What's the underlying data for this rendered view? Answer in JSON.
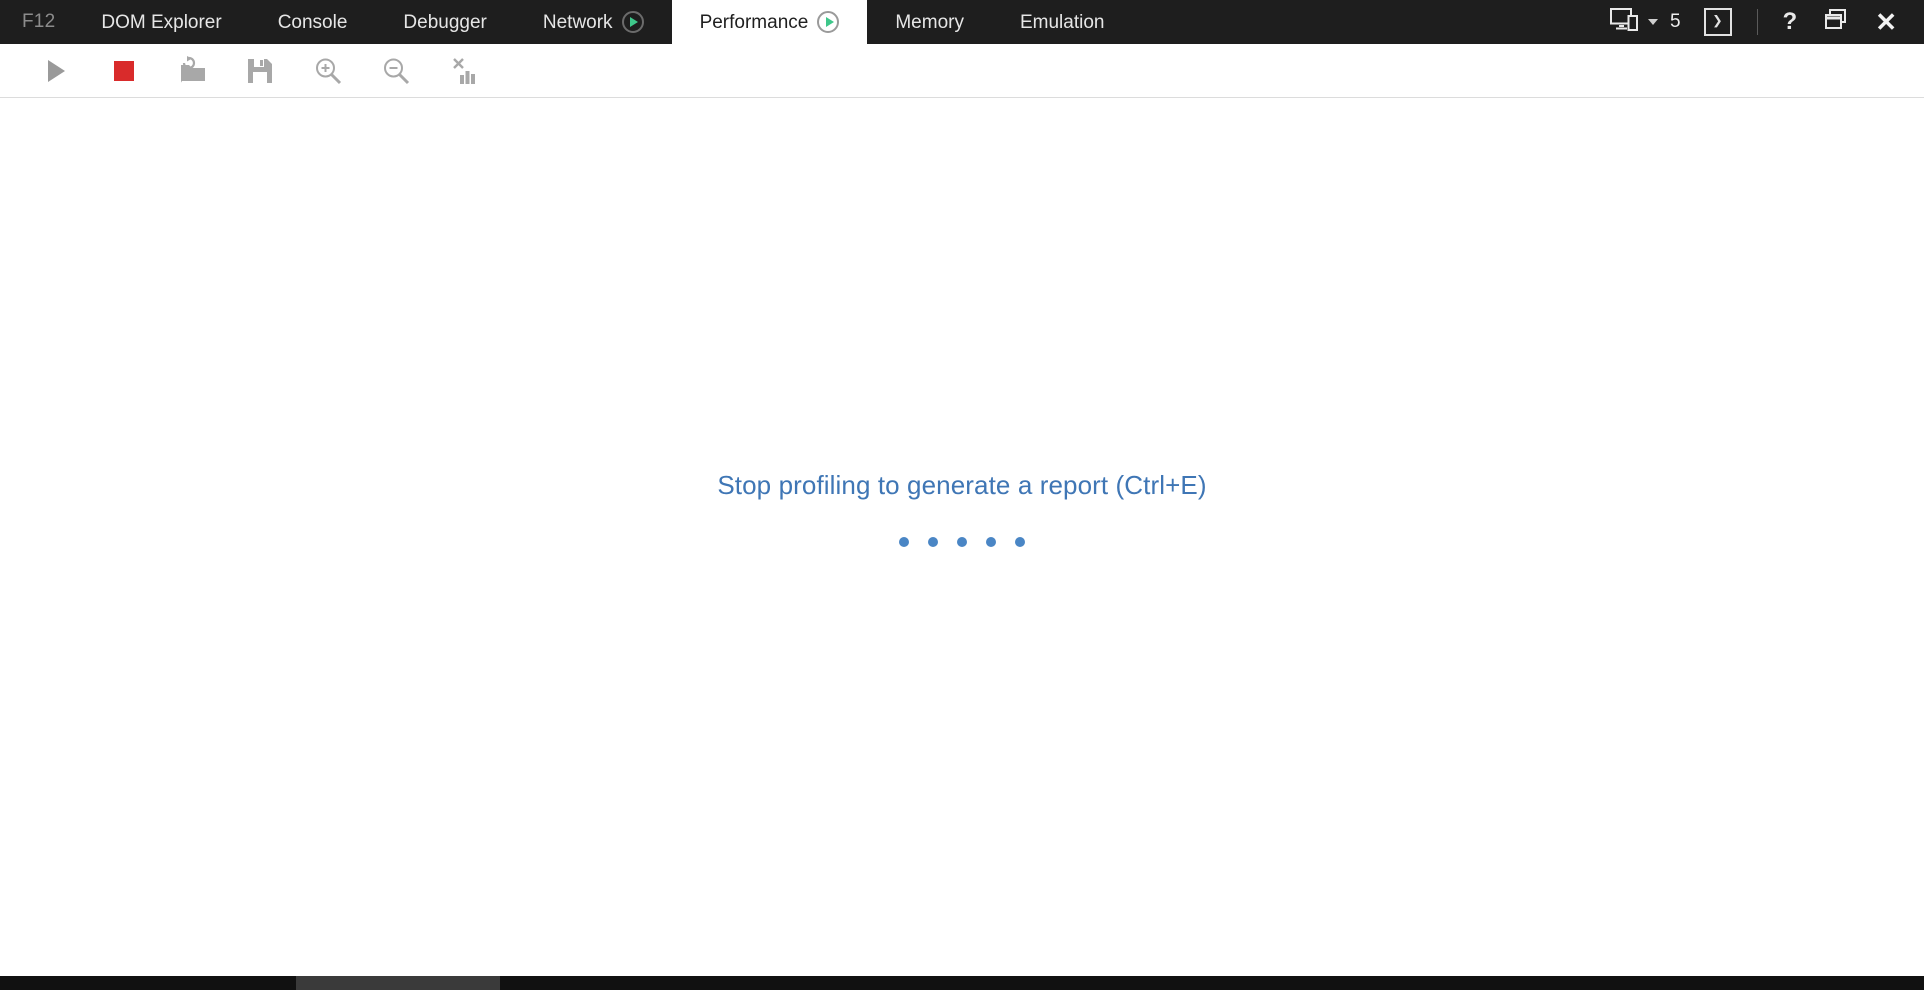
{
  "window": {
    "shortcut_label": "F12",
    "colors": {
      "tabbar_bg": "#1e1e1e",
      "active_tab_bg": "#ffffff",
      "accent_blue": "#3f76b5",
      "record_green": "#3ec78a",
      "stop_red": "#d92b2b"
    }
  },
  "tabs": [
    {
      "label": "DOM Explorer",
      "active": false,
      "recording": false,
      "icon": ""
    },
    {
      "label": "Console",
      "active": false,
      "recording": false,
      "icon": ""
    },
    {
      "label": "Debugger",
      "active": false,
      "recording": false,
      "icon": ""
    },
    {
      "label": "Network",
      "active": false,
      "recording": true,
      "icon": "record-play-icon"
    },
    {
      "label": "Performance",
      "active": true,
      "recording": true,
      "icon": "record-play-icon"
    },
    {
      "label": "Memory",
      "active": false,
      "recording": false,
      "icon": ""
    },
    {
      "label": "Emulation",
      "active": false,
      "recording": false,
      "icon": ""
    }
  ],
  "titlebar_right": {
    "target_icon": "device-target-icon",
    "target_caret": "chevron-down-icon",
    "target_count": "5",
    "console_toggle_icon": "console-prompt-icon",
    "console_toggle_glyph": "❯",
    "help_icon": "help-question-icon",
    "help_glyph": "?",
    "dock_icon": "restore-window-icon",
    "close_icon": "close-icon",
    "close_glyph": "✕"
  },
  "toolbar": [
    {
      "name": "start-profiling-button",
      "icon": "play-icon",
      "label": "Start profiling",
      "enabled": false
    },
    {
      "name": "stop-profiling-button",
      "icon": "stop-icon",
      "label": "Stop profiling",
      "enabled": true
    },
    {
      "name": "open-profile-button",
      "icon": "open-folder-icon",
      "label": "Open profile",
      "enabled": true
    },
    {
      "name": "save-profile-button",
      "icon": "save-floppy-icon",
      "label": "Save profile",
      "enabled": true
    },
    {
      "name": "zoom-in-button",
      "icon": "zoom-in-icon",
      "label": "Zoom in",
      "enabled": true
    },
    {
      "name": "zoom-out-button",
      "icon": "zoom-out-icon",
      "label": "Zoom out",
      "enabled": true
    },
    {
      "name": "clear-report-button",
      "icon": "clear-chart-icon",
      "label": "Clear report",
      "enabled": true
    }
  ],
  "main": {
    "status_message": "Stop profiling to generate a report (Ctrl+E)",
    "loading_dots": 5
  }
}
